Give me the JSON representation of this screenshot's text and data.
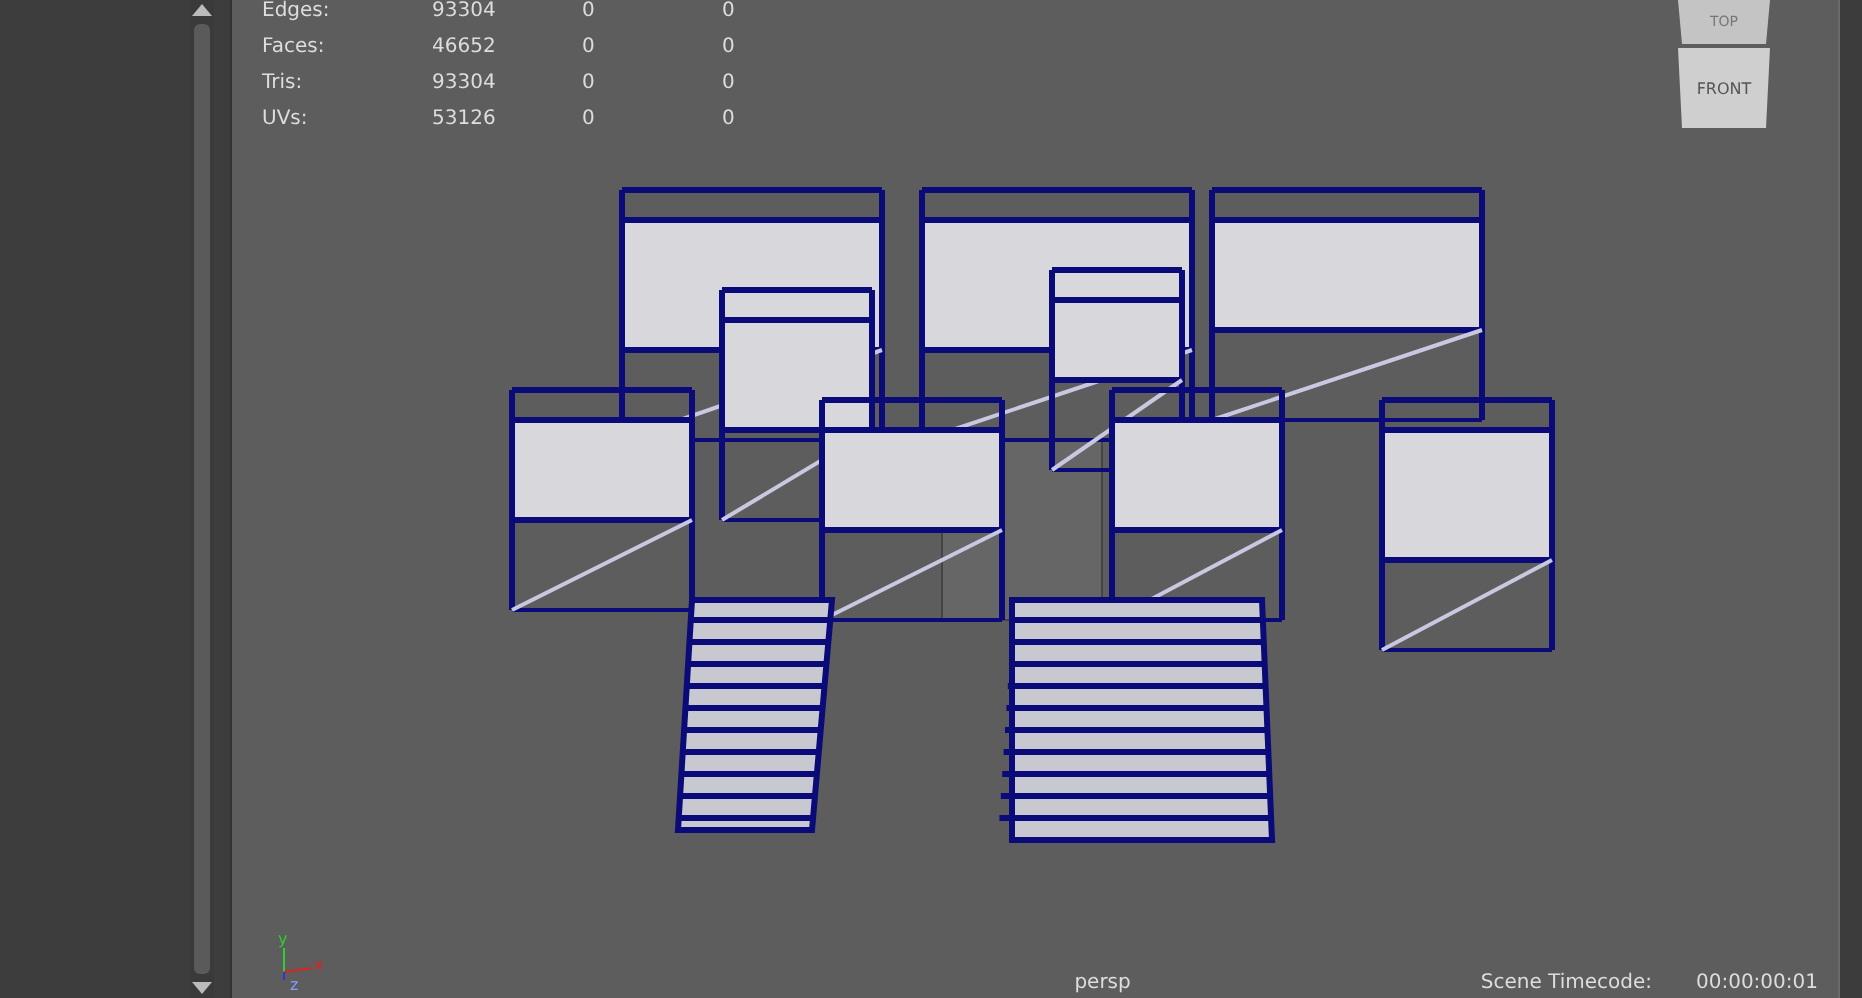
{
  "stats": [
    {
      "label": "Edges:",
      "value": "93304",
      "col_3": "0",
      "col_4": "0"
    },
    {
      "label": "Faces:",
      "value": "46652",
      "col_3": "0",
      "col_4": "0"
    },
    {
      "label": "Tris:",
      "value": "93304",
      "col_3": "0",
      "col_4": "0"
    },
    {
      "label": "UVs:",
      "value": "53126",
      "col_3": "0",
      "col_4": "0"
    }
  ],
  "view_cube": {
    "top": "TOP",
    "front": "FRONT"
  },
  "axis": {
    "y": "y",
    "x": "x",
    "z": "z"
  },
  "camera": "persp",
  "timecode": {
    "label": "Scene Timecode:",
    "value": "00:00:00:01"
  }
}
